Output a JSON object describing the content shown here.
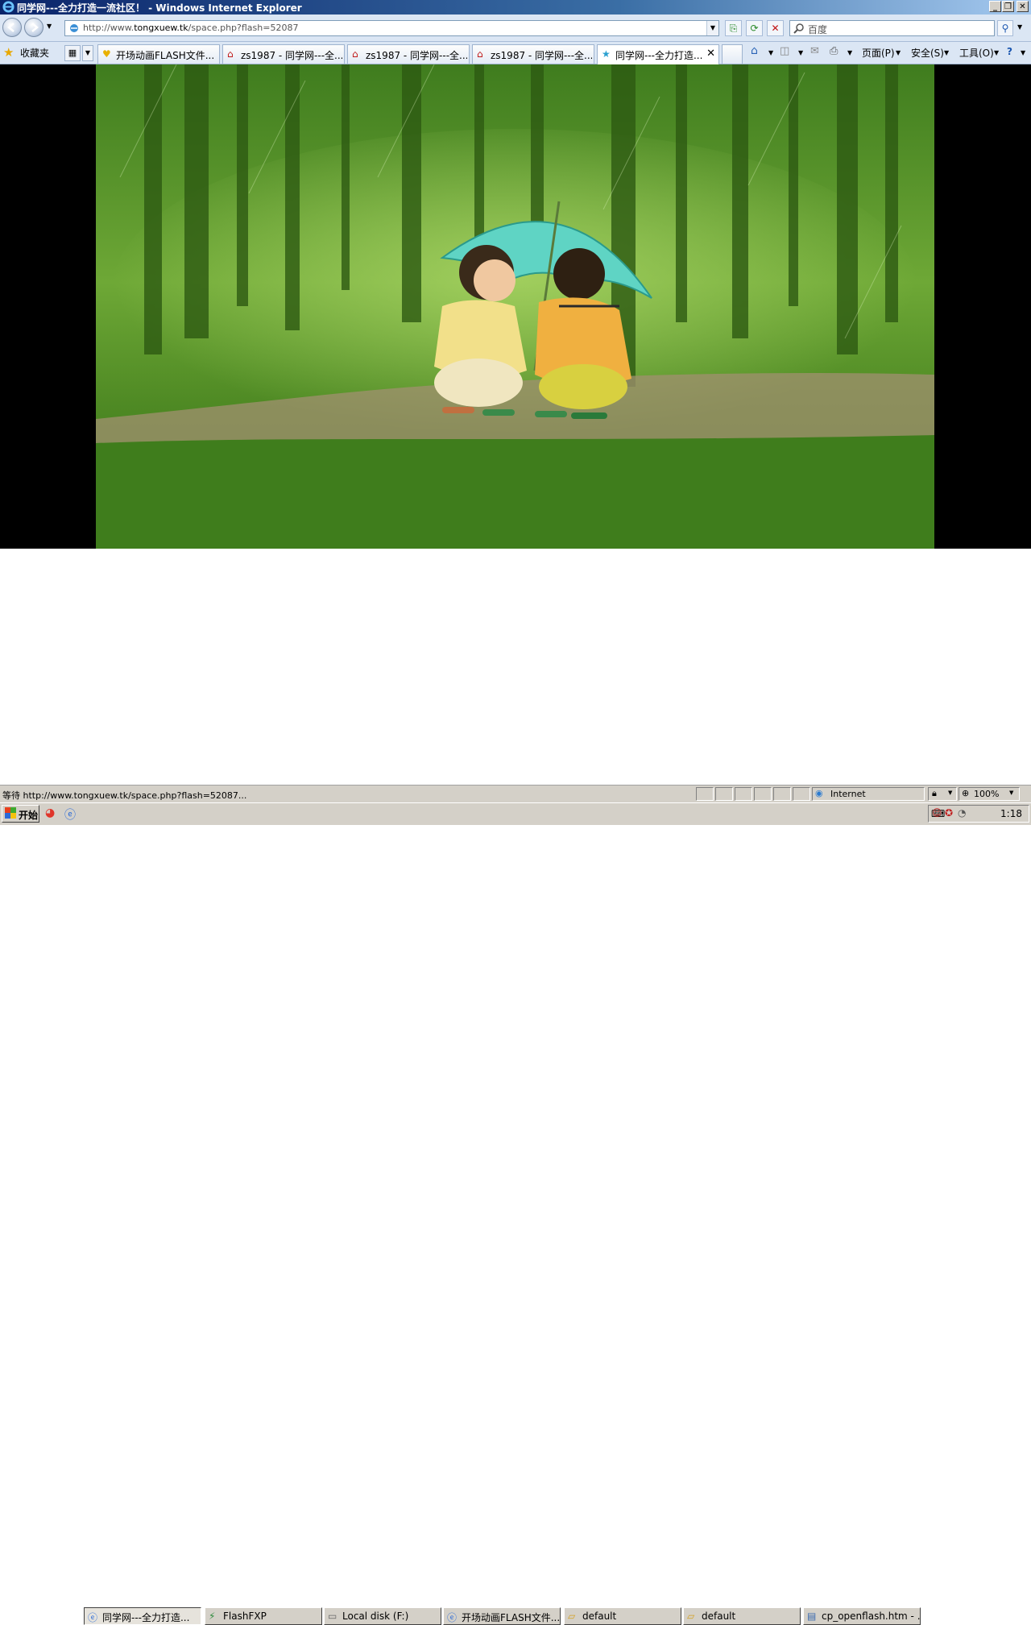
{
  "window": {
    "title": "同学网---全力打造一流社区！ - Windows Internet Explorer"
  },
  "address_bar": {
    "url_prefix": "http://www.",
    "url_domain": "tongxuew.tk",
    "url_path": "/space.php?flash=52087"
  },
  "search": {
    "placeholder": "百度"
  },
  "favorites": {
    "label": "收藏夹"
  },
  "tabs": [
    {
      "label": "开场动画FLASH文件...",
      "icon": "folder-heart-icon",
      "active": false
    },
    {
      "label": "zs1987 - 同学网---全...",
      "icon": "home-icon",
      "active": false
    },
    {
      "label": "zs1987 - 同学网---全...",
      "icon": "home-icon",
      "active": false
    },
    {
      "label": "zs1987 - 同学网---全...",
      "icon": "home-icon",
      "active": false
    },
    {
      "label": "同学网---全力打造...",
      "icon": "star-icon",
      "active": true
    }
  ],
  "command_bar": {
    "page_label": "页面(P)",
    "safety_label": "安全(S)",
    "tools_label": "工具(O)"
  },
  "status_bar": {
    "text": "等待 http://www.tongxuew.tk/space.php?flash=52087...",
    "zone": "Internet",
    "zoom": "100%"
  },
  "taskbar": {
    "start_label": "开始",
    "buttons": [
      {
        "label": "同学网---全力打造...",
        "pressed": true
      },
      {
        "label": "FlashFXP",
        "pressed": false
      },
      {
        "label": "Local disk (F:)",
        "pressed": false
      },
      {
        "label": "开场动画FLASH文件...",
        "pressed": false
      },
      {
        "label": "default",
        "pressed": false
      },
      {
        "label": "default",
        "pressed": false
      },
      {
        "label": "cp_openflash.htm - ...",
        "pressed": false
      }
    ],
    "clock": "1:18"
  },
  "colors": {
    "titlebar_start": "#0a246a",
    "chrome_bg": "#dbe6f4",
    "scene_green": "#5d9a30"
  }
}
